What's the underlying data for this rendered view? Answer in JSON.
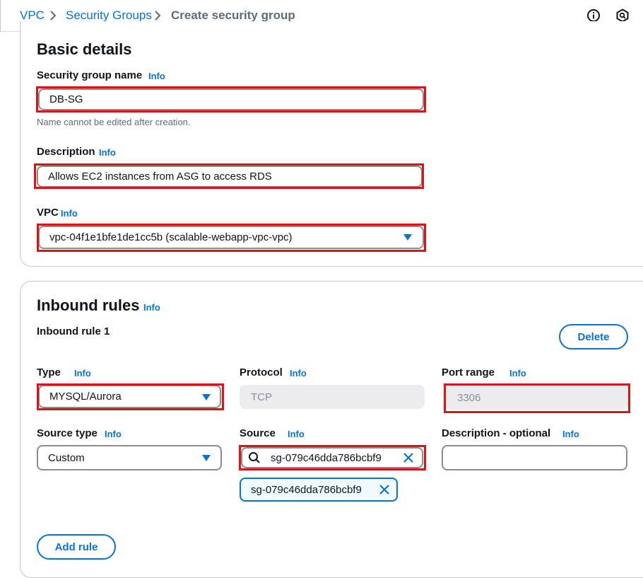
{
  "breadcrumb": {
    "items": [
      {
        "label": "VPC"
      },
      {
        "label": "Security Groups"
      },
      {
        "label": "Create security group"
      }
    ]
  },
  "basic_details": {
    "title": "Basic details",
    "name_label": "Security group name",
    "name_info": "Info",
    "name_value": "DB-SG",
    "name_hint": "Name cannot be edited after creation.",
    "description_label": "Description",
    "description_info": "Info",
    "description_value": "Allows EC2 instances from ASG to access RDS",
    "vpc_label": "VPC",
    "vpc_info": "Info",
    "vpc_value": "vpc-04f1e1bfe1de1cc5b (scalable-webapp-vpc-vpc)"
  },
  "inbound": {
    "title": "Inbound rules",
    "title_info": "Info",
    "rule_title": "Inbound rule 1",
    "delete_label": "Delete",
    "type_label": "Type",
    "type_info": "Info",
    "type_value": "MYSQL/Aurora",
    "protocol_label": "Protocol",
    "protocol_info": "Info",
    "protocol_value": "TCP",
    "port_label": "Port range",
    "port_info": "Info",
    "port_value": "3306",
    "source_type_label": "Source type",
    "source_type_info": "Info",
    "source_type_value": "Custom",
    "source_label": "Source",
    "source_info": "Info",
    "source_value": "sg-079c46dda786bcbf9",
    "source_token": "sg-079c46dda786bcbf9",
    "desc_label": "Description - optional",
    "desc_info": "Info",
    "desc_value": "",
    "add_rule_label": "Add rule"
  },
  "colors": {
    "accent": "#0972d3",
    "highlight": "#d91515",
    "border": "#8c8c94"
  }
}
